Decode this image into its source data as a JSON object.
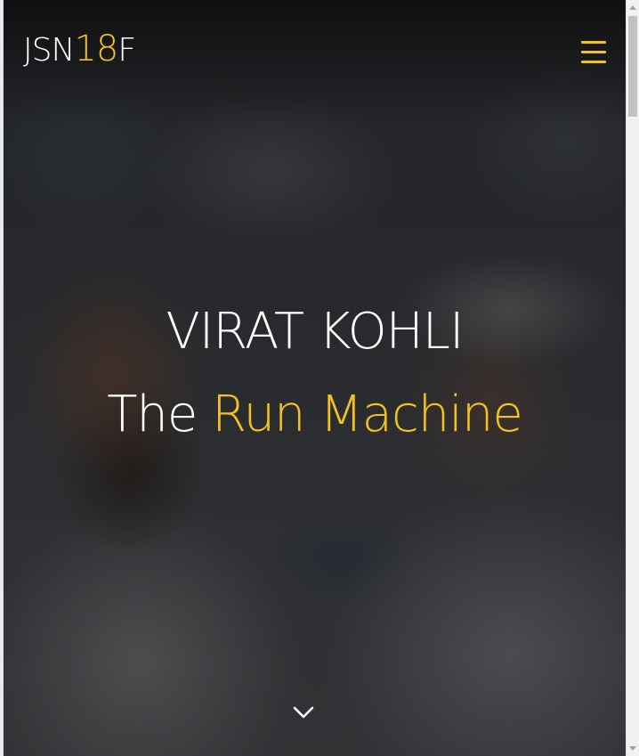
{
  "header": {
    "logo": {
      "main": "JSN",
      "number": "18",
      "tail": "F"
    },
    "menu_icon": "hamburger-menu-icon"
  },
  "hero": {
    "title": "VIRAT KOHLI",
    "tagline_plain": "The ",
    "tagline_accent": "Run Machine",
    "scroll_icon": "chevron-down-icon",
    "background_image": "blurred photo of two men in white shirts and a hat at a cricket ground"
  },
  "colors": {
    "accent": "#f3c222",
    "text": "#ffffff",
    "overlay": "#000000"
  }
}
